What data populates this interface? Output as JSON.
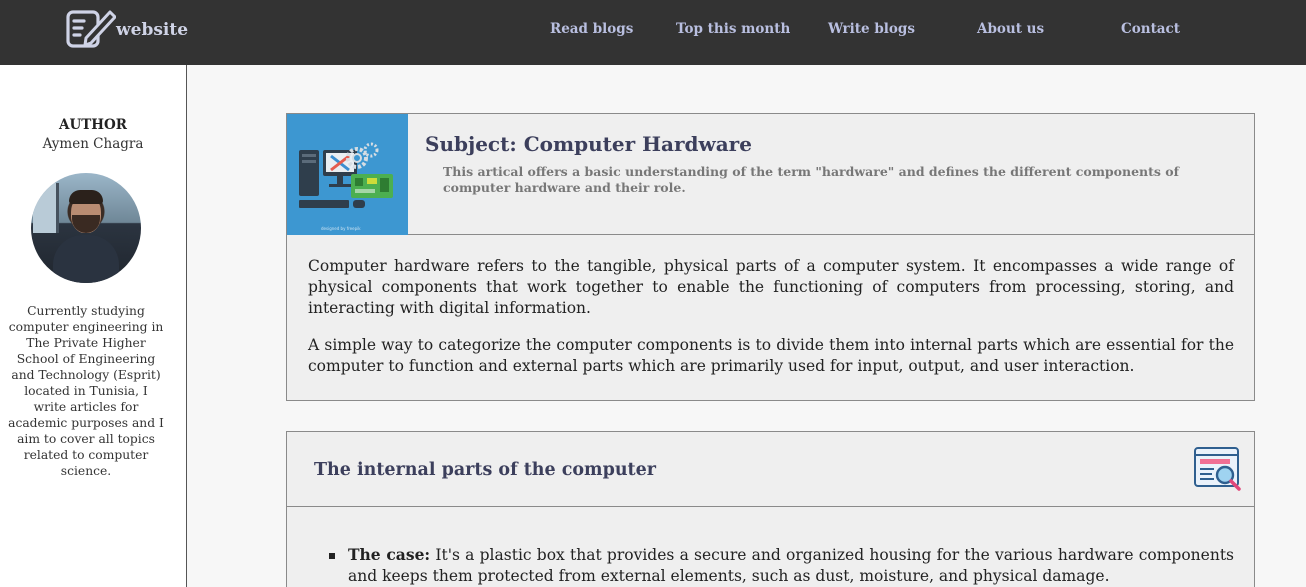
{
  "header": {
    "logo_text": "website",
    "nav": [
      {
        "label": "Read blogs"
      },
      {
        "label": "Top this month"
      },
      {
        "label": "Write blogs"
      },
      {
        "label": "About us"
      },
      {
        "label": "Contact"
      }
    ]
  },
  "sidebar": {
    "author_heading": "AUTHOR",
    "author_name": "Aymen Chagra",
    "bio": "Currently studying computer engineering in The Private Higher School of Engineering and Technology (Esprit) located in Tunisia, I write articles for academic purposes and I aim to cover all topics related to computer science."
  },
  "article": {
    "subject": "Subject: Computer Hardware",
    "description": "This artical offers a basic understanding of the term \"hardware\" and defines the different components of computer hardware and their role.",
    "paragraphs": [
      "Computer hardware refers to the tangible, physical parts of a computer system. It encompasses a wide range of physical components that work together to enable the functioning of computers from processing, storing, and interacting with digital information.",
      "A simple way to categorize the computer components is to divide them into internal parts which are essential for the computer to function and external parts which are primarily used for input, output, and user interaction."
    ],
    "thumbnail_caption": "designed by freepik"
  },
  "internal_section": {
    "title": "The internal parts of the computer",
    "items": [
      {
        "term": "The case:",
        "text": " It's a plastic box that provides a secure and organized housing for the various hardware components and keeps them protected from external elements, such as dust, moisture, and physical damage."
      }
    ]
  },
  "colors": {
    "topbar": "#333333",
    "nav_text": "#b9bfe0",
    "heading": "#3c3f5c",
    "card_bg": "#efefef",
    "thumb_bg": "#3d97d1"
  }
}
